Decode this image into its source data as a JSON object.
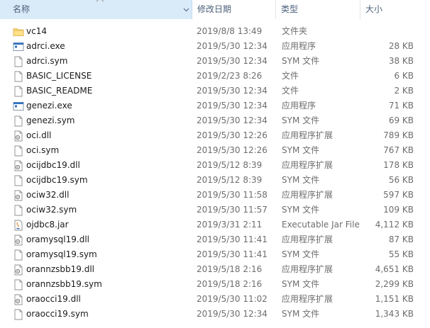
{
  "columns": {
    "name": "名称",
    "date": "修改日期",
    "type": "类型",
    "size": "大小"
  },
  "files": [
    {
      "name": "vc14",
      "date": "2019/8/8 13:49",
      "type": "文件夹",
      "size": "",
      "icon": "folder-icon"
    },
    {
      "name": "adrci.exe",
      "date": "2019/5/30 12:34",
      "type": "应用程序",
      "size": "28 KB",
      "icon": "exe-icon"
    },
    {
      "name": "adrci.sym",
      "date": "2019/5/30 12:34",
      "type": "SYM 文件",
      "size": "38 KB",
      "icon": "file-icon"
    },
    {
      "name": "BASIC_LICENSE",
      "date": "2019/2/23 8:26",
      "type": "文件",
      "size": "6 KB",
      "icon": "file-icon"
    },
    {
      "name": "BASIC_README",
      "date": "2019/5/30 12:34",
      "type": "文件",
      "size": "2 KB",
      "icon": "file-icon"
    },
    {
      "name": "genezi.exe",
      "date": "2019/5/30 12:34",
      "type": "应用程序",
      "size": "71 KB",
      "icon": "exe-icon"
    },
    {
      "name": "genezi.sym",
      "date": "2019/5/30 12:34",
      "type": "SYM 文件",
      "size": "69 KB",
      "icon": "file-icon"
    },
    {
      "name": "oci.dll",
      "date": "2019/5/30 12:26",
      "type": "应用程序扩展",
      "size": "789 KB",
      "icon": "dll-icon"
    },
    {
      "name": "oci.sym",
      "date": "2019/5/30 12:26",
      "type": "SYM 文件",
      "size": "767 KB",
      "icon": "file-icon"
    },
    {
      "name": "ocijdbc19.dll",
      "date": "2019/5/12 8:39",
      "type": "应用程序扩展",
      "size": "178 KB",
      "icon": "dll-icon"
    },
    {
      "name": "ocijdbc19.sym",
      "date": "2019/5/12 8:39",
      "type": "SYM 文件",
      "size": "56 KB",
      "icon": "file-icon"
    },
    {
      "name": "ociw32.dll",
      "date": "2019/5/30 11:58",
      "type": "应用程序扩展",
      "size": "597 KB",
      "icon": "dll-icon"
    },
    {
      "name": "ociw32.sym",
      "date": "2019/5/30 11:57",
      "type": "SYM 文件",
      "size": "109 KB",
      "icon": "file-icon"
    },
    {
      "name": "ojdbc8.jar",
      "date": "2019/3/31 2:11",
      "type": "Executable Jar File",
      "size": "4,112 KB",
      "icon": "jar-icon"
    },
    {
      "name": "oramysql19.dll",
      "date": "2019/5/30 11:41",
      "type": "应用程序扩展",
      "size": "87 KB",
      "icon": "dll-icon"
    },
    {
      "name": "oramysql19.sym",
      "date": "2019/5/30 11:41",
      "type": "SYM 文件",
      "size": "55 KB",
      "icon": "file-icon"
    },
    {
      "name": "orannzsbb19.dll",
      "date": "2019/5/18 2:16",
      "type": "应用程序扩展",
      "size": "4,651 KB",
      "icon": "dll-icon"
    },
    {
      "name": "orannzsbb19.sym",
      "date": "2019/5/18 2:16",
      "type": "SYM 文件",
      "size": "2,299 KB",
      "icon": "file-icon"
    },
    {
      "name": "oraocci19.dll",
      "date": "2019/5/30 11:02",
      "type": "应用程序扩展",
      "size": "1,151 KB",
      "icon": "dll-icon"
    },
    {
      "name": "oraocci19.sym",
      "date": "2019/5/30 12:34",
      "type": "SYM 文件",
      "size": "1,343 KB",
      "icon": "file-icon"
    }
  ]
}
